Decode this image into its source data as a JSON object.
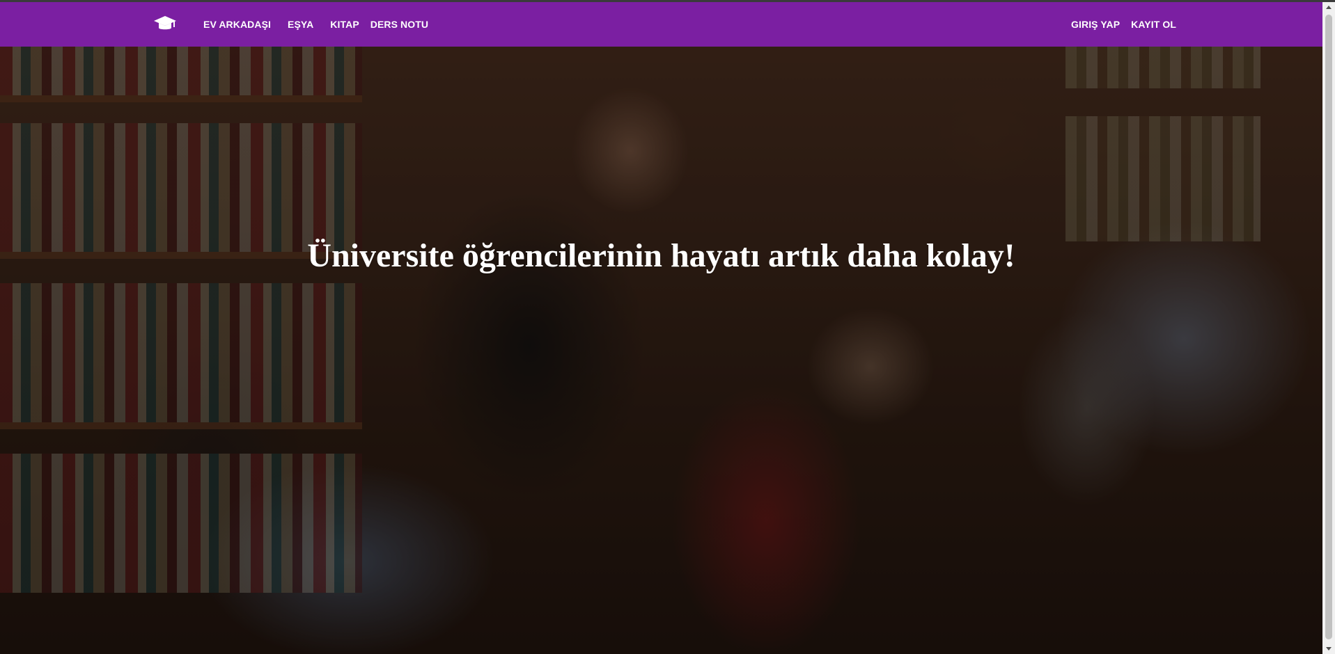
{
  "navbar": {
    "brand_icon": "graduation-cap-icon",
    "background_color": "#7b1fa2",
    "left_links": [
      {
        "label": "EV ARKADAŞI"
      },
      {
        "label": "EŞYA"
      },
      {
        "label": "KITAP"
      },
      {
        "label": "DERS NOTU"
      }
    ],
    "right_links": [
      {
        "label": "GIRIŞ YAP"
      },
      {
        "label": "KAYIT OL"
      }
    ]
  },
  "hero": {
    "title": "Üniversite öğrencilerinin hayatı artık daha kolay!"
  }
}
